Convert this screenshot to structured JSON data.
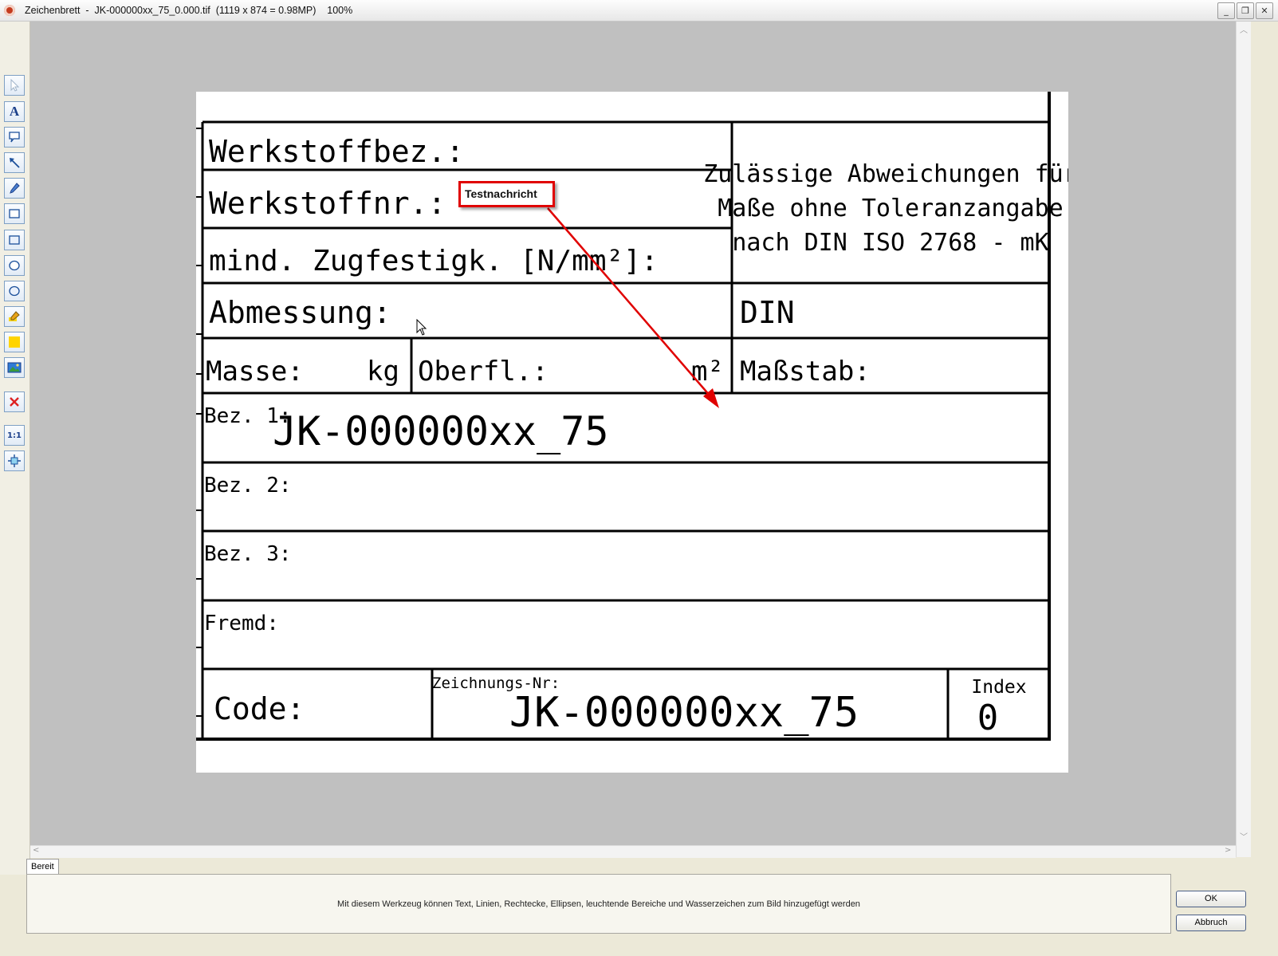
{
  "window": {
    "title": "Zeichenbrett  -  JK-000000xx_75_0.000.tif  (1119 x 874 = 0.98MP)    100%",
    "controls": [
      "_",
      "❐",
      "✕"
    ]
  },
  "toolbar": {
    "tools": [
      {
        "name": "select-arrow-icon"
      },
      {
        "name": "text-tool-icon",
        "label": "A"
      },
      {
        "name": "callout-tool-icon"
      },
      {
        "name": "arrow-line-tool-icon"
      },
      {
        "name": "pen-tool-icon"
      },
      {
        "name": "rectangle-tool-icon"
      },
      {
        "name": "filled-rectangle-tool-icon"
      },
      {
        "name": "ellipse-tool-icon"
      },
      {
        "name": "filled-ellipse-tool-icon"
      },
      {
        "name": "highlighter-tool-icon"
      },
      {
        "name": "highlight-area-tool-icon"
      },
      {
        "name": "watermark-image-tool-icon"
      },
      {
        "name": "delete-icon"
      },
      {
        "name": "zoom-1-1-icon",
        "label": "1:1"
      },
      {
        "name": "fit-to-window-icon"
      }
    ]
  },
  "drawing": {
    "werkstoffbez": "Werkstoffbez.:",
    "werkstoffnr": "Werkstoffnr.:",
    "zugfestigkeit": "mind. Zugfestigk. [N/mm²]:",
    "abmessung": "Abmessung:",
    "tolerance_line1": "Zulässige Abweichungen für",
    "tolerance_line2": "Maße ohne Toleranzangabe",
    "tolerance_line3": "nach DIN ISO 2768 - mK",
    "din": "DIN",
    "masse": "Masse:",
    "kg": "kg",
    "oberfl": "Oberfl.:",
    "m2": "m²",
    "massstab": "Maßstab:",
    "bez1": "Bez. 1:",
    "bez1_value": "JK-000000xx_75",
    "bez2": "Bez. 2:",
    "bez3": "Bez. 3:",
    "fremd": "Fremd:",
    "code": "Code:",
    "zeichnungsnr_label": "Zeichnungs-Nr:",
    "zeichnungsnr_value": "JK-000000xx_75",
    "index_label": "Index",
    "index_value": "0"
  },
  "annotation": {
    "text": "Testnachricht",
    "color": "#e00000"
  },
  "bottom": {
    "tab": "Bereit",
    "info": "Mit diesem Werkzeug können Text, Linien, Rechtecke, Ellipsen, leuchtende Bereiche und Wasserzeichen zum Bild hinzugefügt werden",
    "ok": "OK",
    "cancel": "Abbruch"
  }
}
